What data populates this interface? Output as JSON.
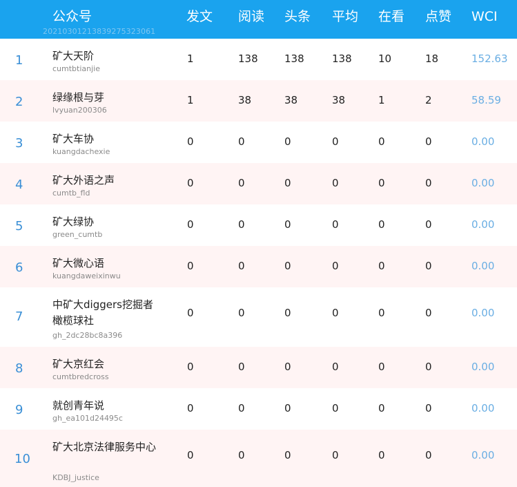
{
  "header": {
    "col_name": "公众号",
    "stamp": "20210301213839275323061",
    "col_posts": "发文",
    "col_reads": "阅读",
    "col_headline": "头条",
    "col_avg": "平均",
    "col_watching": "在看",
    "col_likes": "点赞",
    "col_wci": "WCI"
  },
  "rows": [
    {
      "rank": "1",
      "name": "矿大天阶",
      "account": "cumtbtianjie",
      "posts": "1",
      "reads": "138",
      "headline": "138",
      "avg": "138",
      "watching": "10",
      "likes": "18",
      "wci": "152.63"
    },
    {
      "rank": "2",
      "name": "绿缘根与芽",
      "account": "lvyuan200306",
      "posts": "1",
      "reads": "38",
      "headline": "38",
      "avg": "38",
      "watching": "1",
      "likes": "2",
      "wci": "58.59"
    },
    {
      "rank": "3",
      "name": "矿大车协",
      "account": "kuangdachexie",
      "posts": "0",
      "reads": "0",
      "headline": "0",
      "avg": "0",
      "watching": "0",
      "likes": "0",
      "wci": "0.00"
    },
    {
      "rank": "4",
      "name": "矿大外语之声",
      "account": "cumtb_fld",
      "posts": "0",
      "reads": "0",
      "headline": "0",
      "avg": "0",
      "watching": "0",
      "likes": "0",
      "wci": "0.00"
    },
    {
      "rank": "5",
      "name": "矿大绿协",
      "account": "green_cumtb",
      "posts": "0",
      "reads": "0",
      "headline": "0",
      "avg": "0",
      "watching": "0",
      "likes": "0",
      "wci": "0.00"
    },
    {
      "rank": "6",
      "name": "矿大微心语",
      "account": "kuangdaweixinwu",
      "posts": "0",
      "reads": "0",
      "headline": "0",
      "avg": "0",
      "watching": "0",
      "likes": "0",
      "wci": "0.00"
    },
    {
      "rank": "7",
      "name": "中矿大diggers挖掘者橄榄球社",
      "account": "gh_2dc28bc8a396",
      "posts": "0",
      "reads": "0",
      "headline": "0",
      "avg": "0",
      "watching": "0",
      "likes": "0",
      "wci": "0.00"
    },
    {
      "rank": "8",
      "name": "矿大京红会",
      "account": "cumtbredcross",
      "posts": "0",
      "reads": "0",
      "headline": "0",
      "avg": "0",
      "watching": "0",
      "likes": "0",
      "wci": "0.00"
    },
    {
      "rank": "9",
      "name": "就创青年说",
      "account": "gh_ea101d24495c",
      "posts": "0",
      "reads": "0",
      "headline": "0",
      "avg": "0",
      "watching": "0",
      "likes": "0",
      "wci": "0.00"
    },
    {
      "rank": "10",
      "name": "矿大北京法律服务中心",
      "account": "KDBJ_justice",
      "posts": "0",
      "reads": "0",
      "headline": "0",
      "avg": "0",
      "watching": "0",
      "likes": "0",
      "wci": "0.00"
    }
  ]
}
